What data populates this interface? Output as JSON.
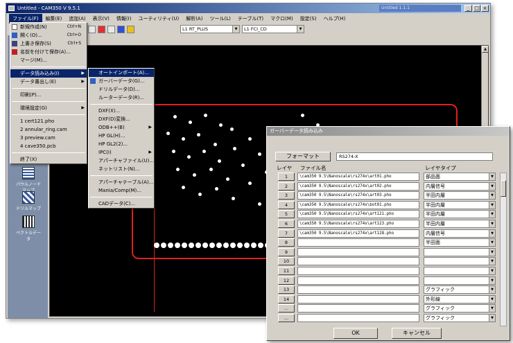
{
  "window": {
    "title": "Untitled - CAM350 V 9.5.1",
    "sub_title": "Untitled 1.1.1",
    "btn_min": "_",
    "btn_max": "□",
    "btn_close": "×"
  },
  "menubar": [
    "ファイル(F)",
    "編集(E)",
    "追加(A)",
    "表示(V)",
    "情報(I)",
    "ユーティリティ(U)",
    "解析(A)",
    "ツール(L)",
    "テーブル(T)",
    "マクロ(M)",
    "設定(S)",
    "ヘルプ(H)"
  ],
  "toolbar": {
    "combo1": "L1 RT_PLUS",
    "combo2": "L1 FCI_CD"
  },
  "file_menu": [
    {
      "label": "新規作成(N)",
      "shortcut": "Ctrl+N"
    },
    {
      "label": "開く(O)...",
      "shortcut": "Ctrl+O"
    },
    {
      "label": "上書き保存(S)",
      "shortcut": "Ctrl+S"
    },
    {
      "label": "名前を付けて保存(A)..."
    },
    {
      "label": "マージ(M)..."
    },
    {
      "label": "データ読み込み(I)"
    },
    {
      "label": "データ書出し(E)"
    },
    {
      "label": "印刷(P)..."
    },
    {
      "label": "環境設定(G)"
    },
    {
      "label": "1 cert121.pho"
    },
    {
      "label": "2 annular_ring.cam"
    },
    {
      "label": "3 preview.cam"
    },
    {
      "label": "4 cave350.pcb"
    },
    {
      "label": "終了(X)"
    }
  ],
  "import_menu": [
    "オートインポート(A)...",
    "ガーバーデータ(G)...",
    "ドリルデータ(D)...",
    "ルーターデータ(R)...",
    "DXF(X)...",
    "DXF(D)変換...",
    "ODB++(B)",
    "HP GL(H)...",
    "HP GL2(2)...",
    "IPC(I)",
    "アパーチャファイル(U)...",
    "ネットリスト(N)...",
    "アパーチャテーブル(A)...",
    "Mania/Comp(M)...",
    "CADデータ(C)..."
  ],
  "left_panel": {
    "tool1": "パウルノードマップ",
    "tool2": "ドリルマップ",
    "tool3": "ベクトルデータ"
  },
  "dialog": {
    "title": "ガーバーデータ読み込み",
    "format_button": "フォーマット",
    "format_value": "RS274-X",
    "col_layer": "レイヤ",
    "col_file": "ファイル名",
    "col_type": "レイヤタイプ",
    "rows": [
      {
        "n": "1",
        "file": "\\cam350 9.5\\Nanoscale\\rs274x\\art01.pho",
        "type": "部品面"
      },
      {
        "n": "2",
        "file": "\\cam350 9.5\\Nanoscale\\rs274x\\art02.pho",
        "type": "内層信号"
      },
      {
        "n": "3",
        "file": "\\cam350 9.5\\Nanoscale\\rs274x\\art03.pho",
        "type": "半田内層"
      },
      {
        "n": "4",
        "file": "\\cam350 9.5\\Nanoscale\\rs274x\\bot01.pho",
        "type": "半田内層"
      },
      {
        "n": "5",
        "file": "\\cam350 9.5\\Nanoscale\\rs274x\\art121.pho",
        "type": "半田内層"
      },
      {
        "n": "6",
        "file": "\\cam350 9.5\\Nanoscale\\rs274x\\art123.pho",
        "type": "半田内層"
      },
      {
        "n": "7",
        "file": "\\cam350 9.5\\Nanoscale\\rs274x\\art128.pho",
        "type": "内層信号"
      },
      {
        "n": "8",
        "file": "",
        "type": "半田面"
      },
      {
        "n": "9",
        "file": "",
        "type": ""
      },
      {
        "n": "10",
        "file": "",
        "type": ""
      },
      {
        "n": "11",
        "file": "",
        "type": ""
      },
      {
        "n": "12",
        "file": "",
        "type": ""
      },
      {
        "n": "13",
        "file": "",
        "type": "グラフィック"
      },
      {
        "n": "14",
        "file": "",
        "type": "外形線"
      },
      {
        "n": "...",
        "file": "",
        "type": "グラフィック"
      },
      {
        "n": "...",
        "file": "",
        "type": "グラフィック"
      }
    ],
    "ok": "OK",
    "cancel": "キャンセル"
  }
}
